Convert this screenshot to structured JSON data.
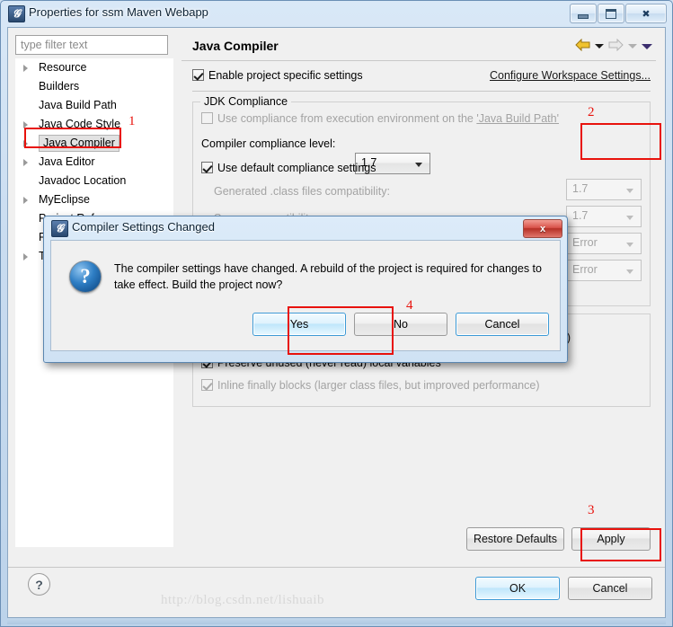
{
  "window": {
    "title": "Properties for ssm Maven Webapp",
    "icon": "eclipse-icon",
    "minimize_label": "Minimize",
    "maximize_label": "Maximize",
    "close_label": "Close"
  },
  "sidebar": {
    "filter": {
      "placeholder": "type filter text",
      "value": ""
    },
    "items": [
      {
        "label": "Resource",
        "expandable": true,
        "selected": false
      },
      {
        "label": "Builders",
        "expandable": false,
        "selected": false
      },
      {
        "label": "Java Build Path",
        "expandable": false,
        "selected": false
      },
      {
        "label": "Java Code Style",
        "expandable": true,
        "selected": false
      },
      {
        "label": "Java Compiler",
        "expandable": true,
        "selected": true
      },
      {
        "label": "Java Editor",
        "expandable": true,
        "selected": false
      },
      {
        "label": "Javadoc Location",
        "expandable": false,
        "selected": false
      },
      {
        "label": "MyEclipse",
        "expandable": true,
        "selected": false
      },
      {
        "label": "Project References",
        "expandable": false,
        "selected": false
      },
      {
        "label": "Run/Debug",
        "expandable": false,
        "selected": false
      },
      {
        "label": "Task Repos",
        "expandable": true,
        "selected": false
      }
    ]
  },
  "pane": {
    "title": "Java Compiler",
    "nav": {
      "back_icon": "back-arrow-icon",
      "back_menu_icon": "chevron-down-icon",
      "forward_icon": "forward-arrow-icon",
      "forward_menu_icon": "chevron-down-icon",
      "view_menu_icon": "chevron-down-icon"
    },
    "enable_project_specific": {
      "label": "Enable project specific settings",
      "checked": true
    },
    "configure_workspace_link": "Configure Workspace Settings...",
    "jdk_group": {
      "label": "JDK Compliance",
      "use_execution_env": {
        "label_prefix": "Use compliance from execution environment on the ",
        "label_link": "'Java Build Path'",
        "checked": false,
        "enabled": false
      },
      "compliance_level": {
        "label": "Compiler compliance level:",
        "value": "1.7",
        "enabled": true
      },
      "use_default_compliance": {
        "label": "Use default compliance settings",
        "checked": true
      },
      "rows": [
        {
          "label": "Generated .class files compatibility:",
          "value": "1.7",
          "enabled": false
        },
        {
          "label": "Source compatibility:",
          "value": "1.7",
          "enabled": false
        },
        {
          "label": "",
          "value": "Error",
          "enabled": false
        },
        {
          "label": "",
          "value": "Error",
          "enabled": false
        }
      ]
    },
    "obscured_fragments": [
      ")",
      "ger)"
    ],
    "classfile_group": {
      "rows": [
        {
          "label": "Preserve unused (never read) local variables",
          "checked": true,
          "enabled": true
        },
        {
          "label": "Inline finally blocks (larger class files, but improved performance)",
          "checked": true,
          "enabled": false
        }
      ]
    },
    "restore_defaults_label": "Restore Defaults",
    "apply_label": "Apply",
    "help_icon": "question-mark-icon"
  },
  "footer": {
    "ok_label": "OK",
    "cancel_label": "Cancel"
  },
  "dialog": {
    "icon": "eclipse-icon",
    "title": "Compiler Settings Changed",
    "close_label": "x",
    "message_icon": "question-icon",
    "message": "The compiler settings have changed. A rebuild of the project is required for changes to take effect. Build the project now?",
    "buttons": [
      {
        "label": "Yes",
        "style": "primary"
      },
      {
        "label": "No",
        "style": "normal"
      },
      {
        "label": "Cancel",
        "style": "focused"
      }
    ]
  },
  "annotations": [
    {
      "number": "1",
      "target": "sidebar-item-java-compiler"
    },
    {
      "number": "2",
      "target": "compliance-level-combo"
    },
    {
      "number": "3",
      "target": "apply-button"
    },
    {
      "number": "4",
      "target": "dialog-yes-button"
    }
  ],
  "watermark": "http://blog.csdn.net/lishuaib",
  "colors": {
    "annotation_red": "#e8120c",
    "title_blue": "#cfe2f4",
    "pane_bg": "#f0f0f0",
    "accent_blue": "#3c9ad6"
  }
}
